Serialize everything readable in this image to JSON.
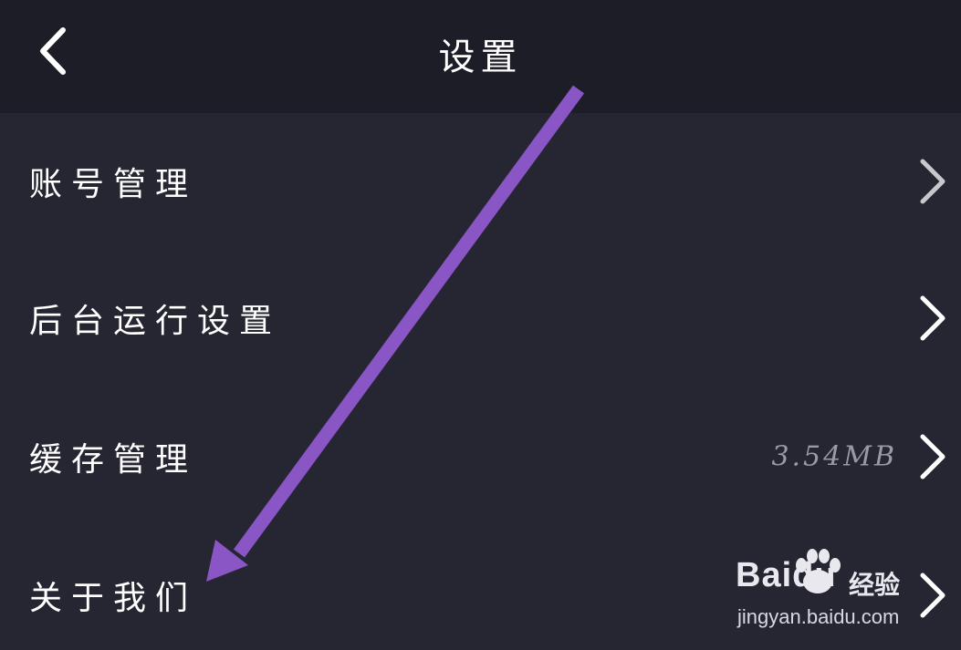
{
  "header": {
    "title": "设置",
    "back_icon": "chevron-left-icon"
  },
  "settings": {
    "items": [
      {
        "label": "账号管理",
        "value": "",
        "icon": "chevron-right-icon"
      },
      {
        "label": "后台运行设置",
        "value": "",
        "icon": "chevron-right-icon"
      },
      {
        "label": "缓存管理",
        "value": "3.54MB",
        "icon": "chevron-right-icon"
      },
      {
        "label": "关于我们",
        "value": "",
        "icon": "chevron-right-icon"
      }
    ]
  },
  "watermark": {
    "brand": "Baidu",
    "sub": "经验",
    "url": "jingyan.baidu.com"
  },
  "colors": {
    "header_bg": "#1d1d27",
    "page_bg": "#262633",
    "arrow": "#8a55c4",
    "value_text": "#9a9aa6"
  }
}
